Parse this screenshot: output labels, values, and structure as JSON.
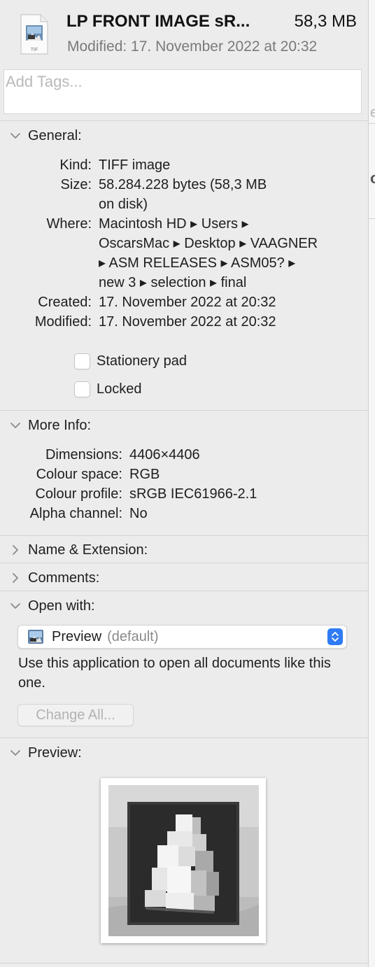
{
  "header": {
    "title": "LP FRONT IMAGE sR...",
    "size": "58,3 MB",
    "modified": "Modified: 17. November 2022 at 20:32",
    "icon_label": "TIF"
  },
  "tags": {
    "placeholder": "Add Tags..."
  },
  "general": {
    "heading": "General:",
    "rows": [
      {
        "key": "Kind:",
        "value": "TIFF image"
      },
      {
        "key": "Size:",
        "value": "58.284.228 bytes (58,3 MB",
        "value2": "on disk)"
      },
      {
        "key": "Where:",
        "value": "Macintosh HD ▸ Users ▸",
        "value2": "OscarsMac ▸ Desktop ▸ VAAGNER",
        "value3": "▸ ASM RELEASES ▸ ASM05? ▸",
        "value4": "new 3 ▸ selection ▸ final"
      },
      {
        "key": "Created:",
        "value": "17. November 2022 at 20:32"
      },
      {
        "key": "Modified:",
        "value": "17. November 2022 at 20:32"
      }
    ],
    "stationery_label": "Stationery pad",
    "stationery_checked": false,
    "locked_label": "Locked",
    "locked_checked": false
  },
  "more_info": {
    "heading": "More Info:",
    "rows": [
      {
        "key": "Dimensions:",
        "value": "4406×4406"
      },
      {
        "key": "Colour space:",
        "value": "RGB"
      },
      {
        "key": "Colour profile:",
        "value": "sRGB IEC61966-2.1"
      },
      {
        "key": "Alpha channel:",
        "value": "No"
      }
    ]
  },
  "name_extension": {
    "heading": "Name & Extension:",
    "expanded": false
  },
  "comments": {
    "heading": "Comments:",
    "expanded": false
  },
  "open_with": {
    "heading": "Open with:",
    "app": "Preview",
    "default_label": "(default)",
    "description": "Use this application to open all documents like this one.",
    "change_all_label": "Change All..."
  },
  "preview": {
    "heading": "Preview:"
  },
  "colors": {
    "panel_bg": "#ececec",
    "accent": "#2f7bf5",
    "secondary_text": "#7a7a7a"
  }
}
